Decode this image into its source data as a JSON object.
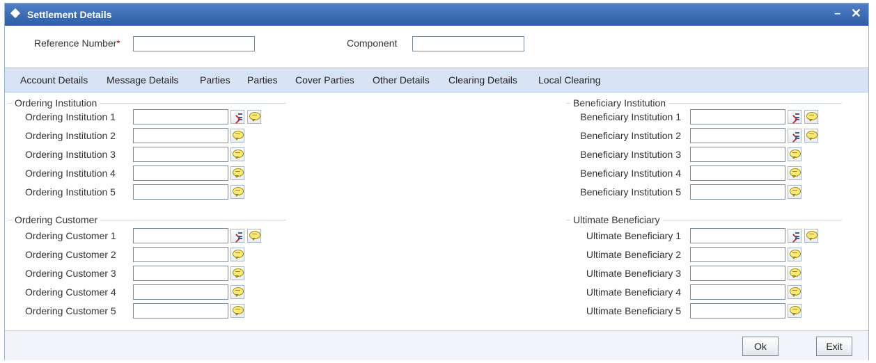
{
  "window": {
    "title": "Settlement Details",
    "minimize_glyph": "–",
    "close_glyph": "✕"
  },
  "header": {
    "reference_label": "Reference Number",
    "required_marker": "*",
    "reference_value": "",
    "component_label": "Component",
    "component_value": ""
  },
  "tabs": [
    {
      "label": "Account Details"
    },
    {
      "label": "Message Details"
    },
    {
      "label": "Parties"
    },
    {
      "label": "Parties"
    },
    {
      "label": "Cover Parties"
    },
    {
      "label": "Other Details"
    },
    {
      "label": "Clearing Details"
    },
    {
      "label": "Local Clearing"
    }
  ],
  "sections": {
    "ordering_institution": {
      "title": "Ordering Institution",
      "rows": [
        {
          "label": "Ordering Institution 1",
          "value": ""
        },
        {
          "label": "Ordering Institution 2",
          "value": ""
        },
        {
          "label": "Ordering Institution 3",
          "value": ""
        },
        {
          "label": "Ordering Institution 4",
          "value": ""
        },
        {
          "label": "Ordering Institution 5",
          "value": ""
        }
      ]
    },
    "ordering_customer": {
      "title": "Ordering Customer",
      "rows": [
        {
          "label": "Ordering Customer 1",
          "value": ""
        },
        {
          "label": "Ordering Customer 2",
          "value": ""
        },
        {
          "label": "Ordering Customer 3",
          "value": ""
        },
        {
          "label": "Ordering Customer 4",
          "value": ""
        },
        {
          "label": "Ordering Customer 5",
          "value": ""
        }
      ]
    },
    "beneficiary_institution": {
      "title": "Beneficiary Institution",
      "rows": [
        {
          "label": "Beneficiary Institution 1",
          "value": ""
        },
        {
          "label": "Beneficiary Institution 2",
          "value": ""
        },
        {
          "label": "Beneficiary Institution 3",
          "value": ""
        },
        {
          "label": "Beneficiary Institution 4",
          "value": ""
        },
        {
          "label": "Beneficiary Institution 5",
          "value": ""
        }
      ]
    },
    "ultimate_beneficiary": {
      "title": "Ultimate Beneficiary",
      "rows": [
        {
          "label": "Ultimate Beneficiary 1",
          "value": ""
        },
        {
          "label": "Ultimate Beneficiary 2",
          "value": ""
        },
        {
          "label": "Ultimate Beneficiary 3",
          "value": ""
        },
        {
          "label": "Ultimate Beneficiary 4",
          "value": ""
        },
        {
          "label": "Ultimate Beneficiary 5",
          "value": ""
        }
      ]
    }
  },
  "buttons": {
    "ok": "Ok",
    "exit": "Exit"
  },
  "icons": {
    "lov": "list-of-values-icon",
    "message": "speech-bubble-icon"
  }
}
